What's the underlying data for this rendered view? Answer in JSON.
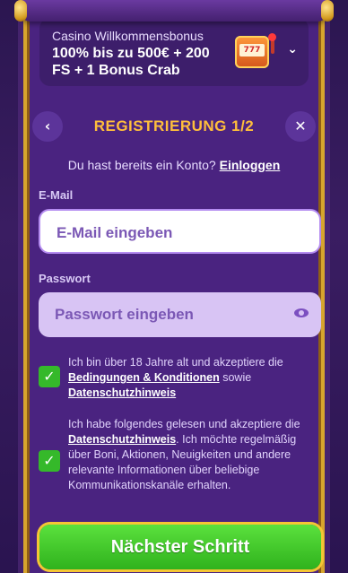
{
  "bonus": {
    "subtitle": "Casino Willkommensbonus",
    "title": "100% bis zu 500€ + 200 FS + 1 Bonus Crab",
    "slot_text": "777",
    "chevron_icon": "chevron-down-icon"
  },
  "header": {
    "title": "REGISTRIERUNG 1/2",
    "back_glyph": "‹",
    "close_glyph": "✕"
  },
  "login": {
    "prompt": "Du hast bereits ein Konto?",
    "link": "Einloggen"
  },
  "email": {
    "label": "E-Mail",
    "placeholder": "E-Mail eingeben"
  },
  "password": {
    "label": "Passwort",
    "placeholder": "Passwort eingeben"
  },
  "consent1": {
    "checked": true,
    "text_a": "Ich bin über 18 Jahre alt und akzeptiere die",
    "link_terms": "Bedingungen & Konditionen",
    "text_b": "sowie",
    "link_privacy": "Datenschutzhinweis"
  },
  "consent2": {
    "checked": true,
    "text_a": "Ich habe folgendes gelesen und akzeptiere die",
    "link_privacy": "Datenschutzhinweis",
    "text_b": ". Ich möchte regelmäßig über Boni, Aktionen, Neuigkeiten und andere relevante Informationen über beliebige Kommunikationskanäle erhalten."
  },
  "check_glyph": "✓",
  "next_button": "Nächster Schritt",
  "colors": {
    "panel": "#4a2380",
    "title_gold": "#ffbe3b",
    "button_green": "#35b92a",
    "frame_gold": "#d7a52d"
  }
}
